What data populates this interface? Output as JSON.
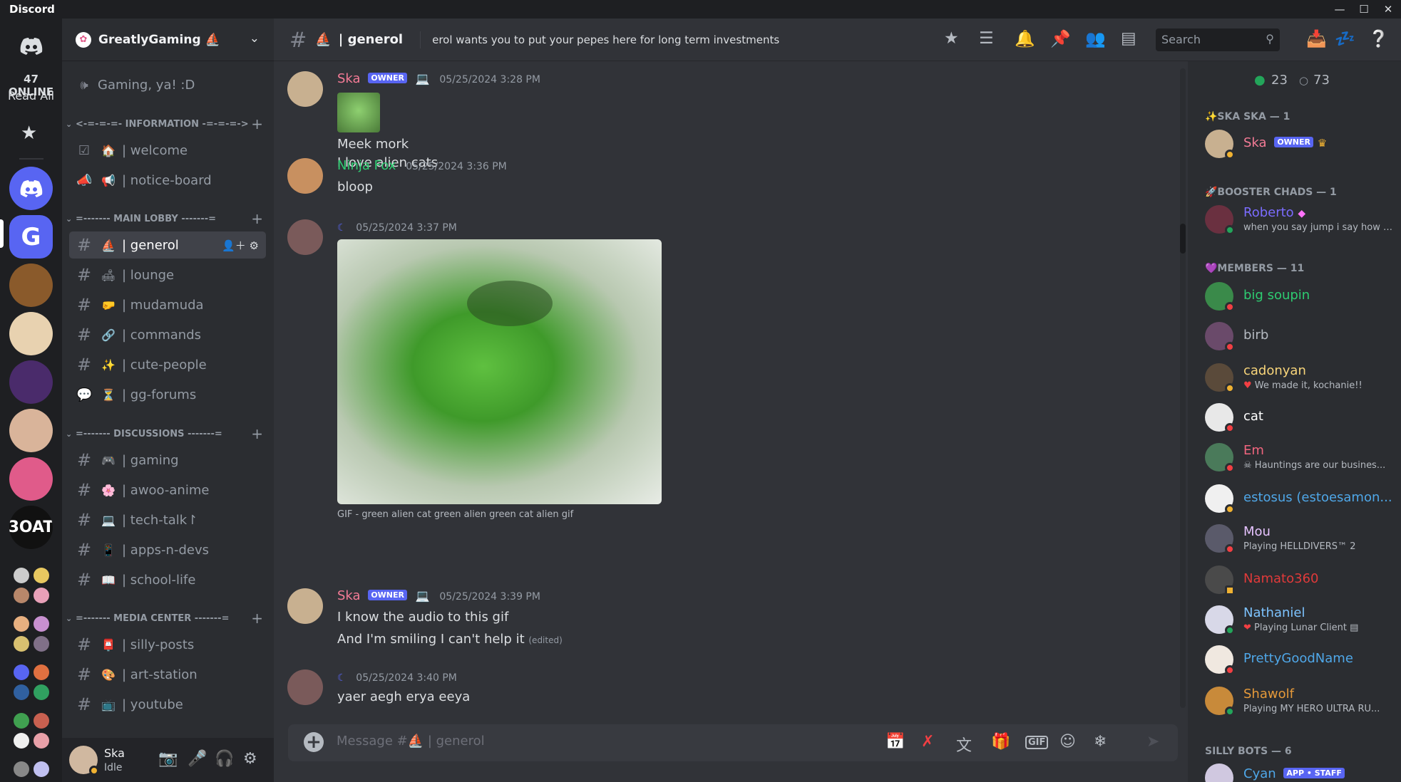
{
  "app": {
    "title": "Discord"
  },
  "rail": {
    "online_count": "47 ONLINE",
    "read_all": "Read All"
  },
  "guild": {
    "name": "GreatlyGaming ⛵"
  },
  "stage": {
    "name": "Gaming, ya! :D"
  },
  "categories": {
    "information": "<-=-=-=- INFORMATION -=-=-=->",
    "main_lobby": "=------- MAIN LOBBY -------=",
    "discussions": "=------- DISCUSSIONS -------=",
    "media_center": "=------- MEDIA CENTER -------="
  },
  "channels": {
    "welcome": "| welcome",
    "notice_board": "| notice-board",
    "generol": "| generol",
    "lounge": "| lounge",
    "mudamuda": "| mudamuda",
    "commands": "| commands",
    "cute_people": "| cute-people",
    "gg_forums": "| gg-forums",
    "gaming": "| gaming",
    "awoo_anime": "| awoo-anime",
    "tech_talk": "| tech-talk↾",
    "apps_n_devs": "| apps-n-devs",
    "school_life": "| school-life",
    "silly_posts": "| silly-posts",
    "art_station": "| art-station",
    "youtube": "| youtube"
  },
  "user": {
    "name": "Ska",
    "status": "Idle"
  },
  "header": {
    "channel": "| generol",
    "topic": "erol wants you to put your pepes here for long term investments",
    "search_placeholder": "Search"
  },
  "messages": [
    {
      "author": "Ska",
      "badge": "OWNER",
      "time": "05/25/2024 3:28 PM",
      "lines": [
        "Meek mork",
        "I love alien cats"
      ]
    },
    {
      "author": "Ninja Fox",
      "time": "05/25/2024 3:36 PM",
      "lines": [
        "bloop"
      ]
    },
    {
      "author": "☾",
      "time": "05/25/2024 3:37 PM",
      "caption": "GIF - green alien cat green alien green cat alien gif"
    },
    {
      "author": "Ska",
      "badge": "OWNER",
      "time": "05/25/2024 3:39 PM",
      "lines": [
        "I know the audio to this gif",
        "And I'm smiling I can't help it"
      ],
      "edited": "(edited)"
    },
    {
      "author": "☾",
      "time": "05/25/2024 3:40 PM",
      "lines": [
        "yaer aegh erya eeya"
      ]
    }
  ],
  "composer": {
    "placeholder": "Message #⛵ | generol"
  },
  "member_list": {
    "online": "23",
    "offline": "73",
    "groups": {
      "ska": "✨SKA SKA — 1",
      "booster": "🚀BOOSTER CHADS — 1",
      "members": "💜MEMBERS — 11",
      "bots": "SILLY BOTS — 6"
    },
    "people": [
      {
        "name": "Ska",
        "badge": "OWNER",
        "color": "#f47b96"
      },
      {
        "name": "Roberto",
        "status": "when you say jump i say how h...",
        "color": "#7b6cff"
      },
      {
        "name": "big soupin",
        "color": "#2ecc71"
      },
      {
        "name": "birb",
        "color": "#b5bac1"
      },
      {
        "name": "cadonyan",
        "status": "We made it, kochanie!!",
        "color": "#f8d57a"
      },
      {
        "name": "cat",
        "color": "#ffffff"
      },
      {
        "name": "Em",
        "status": "Hauntings are our busines...",
        "color": "#f0657e"
      },
      {
        "name": "estosus (estoesamon...",
        "color": "#4fa7e8"
      },
      {
        "name": "Mou",
        "status": "Playing HELLDIVERS™ 2",
        "color": "#e6c3ff"
      },
      {
        "name": "Namato360",
        "color": "#e03a3a"
      },
      {
        "name": "Nathaniel",
        "status": "Playing Lunar Client",
        "color": "#7dc3ff"
      },
      {
        "name": "PrettyGoodName",
        "color": "#4fa7e8"
      },
      {
        "name": "Shawolf",
        "status": "Playing MY HERO ULTRA RU...",
        "color": "#e69a3a"
      },
      {
        "name": "Cyan",
        "badge": "APP • STAFF",
        "color": "#4fa7e8"
      }
    ]
  },
  "colors": {
    "brand": "#5865f2",
    "online": "#23a55a",
    "dnd": "#f23f43",
    "idle": "#f0b232"
  }
}
